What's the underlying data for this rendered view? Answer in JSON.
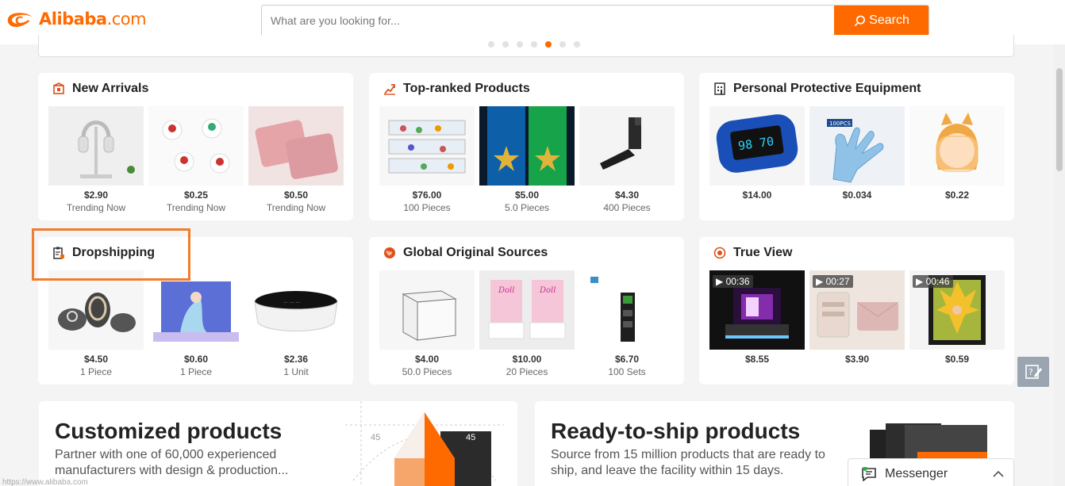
{
  "header": {
    "logo_text": "Alibaba",
    "logo_domain": ".com",
    "search_placeholder": "What are you looking for...",
    "search_label": "Search"
  },
  "carousel": {
    "dots": 7,
    "active_dot": 5
  },
  "cards": [
    {
      "title": "New Arrivals",
      "icon": "new-arrivals-icon",
      "items": [
        {
          "price": "$2.90",
          "sub": "Trending Now"
        },
        {
          "price": "$0.25",
          "sub": "Trending Now"
        },
        {
          "price": "$0.50",
          "sub": "Trending Now"
        }
      ]
    },
    {
      "title": "Top-ranked Products",
      "icon": "top-ranked-icon",
      "items": [
        {
          "price": "$76.00",
          "sub": "100 Pieces"
        },
        {
          "price": "$5.00",
          "sub": "5.0 Pieces"
        },
        {
          "price": "$4.30",
          "sub": "400 Pieces"
        }
      ]
    },
    {
      "title": "Personal Protective Equipment",
      "icon": "ppe-icon",
      "items": [
        {
          "price": "$14.00",
          "sub": ""
        },
        {
          "price": "$0.034",
          "sub": ""
        },
        {
          "price": "$0.22",
          "sub": ""
        }
      ]
    },
    {
      "title": "Dropshipping",
      "icon": "dropshipping-icon",
      "items": [
        {
          "price": "$4.50",
          "sub": "1 Piece"
        },
        {
          "price": "$0.60",
          "sub": "1 Piece"
        },
        {
          "price": "$2.36",
          "sub": "1 Unit"
        }
      ]
    },
    {
      "title": "Global Original Sources",
      "icon": "global-sources-icon",
      "items": [
        {
          "price": "$4.00",
          "sub": "50.0 Pieces"
        },
        {
          "price": "$10.00",
          "sub": "20 Pieces"
        },
        {
          "price": "$6.70",
          "sub": "100 Sets"
        }
      ]
    },
    {
      "title": "True View",
      "icon": "true-view-icon",
      "items": [
        {
          "price": "$8.55",
          "sub": "",
          "video": "00:36"
        },
        {
          "price": "$3.90",
          "sub": "",
          "video": "00:27"
        },
        {
          "price": "$0.59",
          "sub": "",
          "video": "00:46"
        }
      ]
    }
  ],
  "thumb_labels": {
    "badge_100pcs": "100PCS",
    "pencil_45_left": "45",
    "pencil_45_right": "45"
  },
  "promos": [
    {
      "title": "Customized products",
      "desc_line1": "Partner with one of 60,000 experienced",
      "desc_line2": "manufacturers with design & production..."
    },
    {
      "title": "Ready-to-ship products",
      "desc_line1": "Source from 15 million products that are ready to",
      "desc_line2": "ship, and leave the facility within 15 days."
    }
  ],
  "messenger": {
    "label": "Messenger"
  },
  "status_bar": {
    "url": "https://www.alibaba.com"
  },
  "colors": {
    "brand": "#ff6a00",
    "highlight": "#f07c2c"
  }
}
